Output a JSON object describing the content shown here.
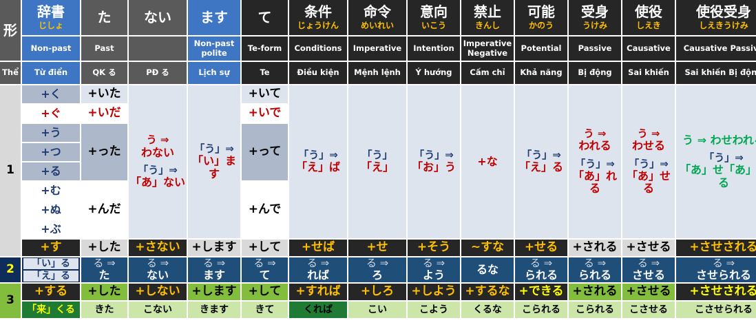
{
  "header": {
    "form_label": "形",
    "the_label": "Thể",
    "columns": [
      {
        "kanji": "辞書",
        "reading": "じしょ",
        "en": "Non-past",
        "vi": "Từ điển"
      },
      {
        "kanji": "た",
        "reading": "",
        "en": "Past",
        "vi": "QK る"
      },
      {
        "kanji": "ない",
        "reading": "",
        "en": "",
        "vi": "PĐ る"
      },
      {
        "kanji": "ます",
        "reading": "",
        "en": "Non-past polite",
        "vi": "Lịch sự"
      },
      {
        "kanji": "て",
        "reading": "",
        "en": "Te-form",
        "vi": "Te"
      },
      {
        "kanji": "条件",
        "reading": "じょうけん",
        "en": "Conditions",
        "vi": "Điều kiện"
      },
      {
        "kanji": "命令",
        "reading": "めいれい",
        "en": "Imperative",
        "vi": "Mệnh lệnh"
      },
      {
        "kanji": "意向",
        "reading": "いこう",
        "en": "Intention",
        "vi": "Ý hướng"
      },
      {
        "kanji": "禁止",
        "reading": "きんし",
        "en": "Imperative Negative",
        "vi": "Cấm chỉ"
      },
      {
        "kanji": "可能",
        "reading": "かのう",
        "en": "Potential",
        "vi": "Khả năng"
      },
      {
        "kanji": "受身",
        "reading": "うけみ",
        "en": "Passive",
        "vi": "Bị động"
      },
      {
        "kanji": "使役",
        "reading": "しえき",
        "en": "Causative",
        "vi": "Sai khiến"
      },
      {
        "kanji": "使役受身",
        "reading": "しえきうけみ",
        "en": "Causative Passive",
        "vi": "Sai khiến Bị động"
      }
    ]
  },
  "group1": {
    "label": "1",
    "dict": [
      "+く",
      "+ぐ",
      "+う",
      "+つ",
      "+る",
      "+む",
      "+ぬ",
      "+ぶ"
    ],
    "past": {
      "ku": "+いた",
      "gu": "+いだ",
      "tsu": "+った",
      "mu": "+んだ"
    },
    "nai": {
      "top_a": "う ⇒",
      "top_b": "わない",
      "bot_a": "「う」⇒",
      "bot_b": "「あ」ない"
    },
    "masu": {
      "a": "「う」⇒",
      "b": "「い」ます"
    },
    "te": {
      "ku": "+いて",
      "gu": "+いで",
      "tsu": "+って",
      "mu": "+んで"
    },
    "cond": {
      "a": "「う」⇒",
      "b": "「え」ば"
    },
    "imper": {
      "a": "「う」",
      "b": "「え」"
    },
    "intent": {
      "a": "「う」⇒",
      "b": "「お」う"
    },
    "prohib": "+な",
    "potential": {
      "a": "「う」⇒",
      "b": "「え」る"
    },
    "passive": {
      "top_a": "う ⇒",
      "top_b": "われる",
      "bot_a": "「う」⇒",
      "bot_b": "「あ」れる"
    },
    "causative": {
      "top_a": "う ⇒",
      "top_b": "わせる",
      "bot_a": "「う」⇒",
      "bot_b": "「あ」せる"
    },
    "caus_pass": {
      "top": "う ⇒ わせわれる",
      "bot_a": "「う」⇒",
      "bot_b": "「あ」せ「あ」れる"
    },
    "suru_row": [
      "+す",
      "+した",
      "+さない",
      "+します",
      "+して",
      "+せば",
      "+せ",
      "+そう",
      "~すな",
      "+せる",
      "+される",
      "+させる",
      "+させされる"
    ]
  },
  "group2": {
    "label": "2",
    "rows": [
      "「い」る",
      "「え」る"
    ],
    "arrow": "る ⇒",
    "cols": [
      "た",
      "ない",
      "ます",
      "て",
      "れば",
      "ろ",
      "よう",
      "るな",
      "られる",
      "られる",
      "させる",
      "させられる"
    ]
  },
  "group3": {
    "label": "3",
    "suru": [
      "+する",
      "+した",
      "+しない",
      "+します",
      "+して",
      "+すれば",
      "+しろ",
      "+しよう",
      "+するな",
      "+できる",
      "+される",
      "+させる",
      "+させされる"
    ],
    "kuru": [
      "「来」くる",
      "きた",
      "こない",
      "きます",
      "きて",
      "くれば",
      "こい",
      "こよう",
      "くるな",
      "こられる",
      "こられる",
      "こさせる",
      "こさせられる"
    ]
  },
  "colors": {
    "accent_blue": "#3f76c4",
    "red": "#c00000",
    "gold": "#ffc000",
    "green": "#00a651",
    "navy": "#1f3b73"
  }
}
